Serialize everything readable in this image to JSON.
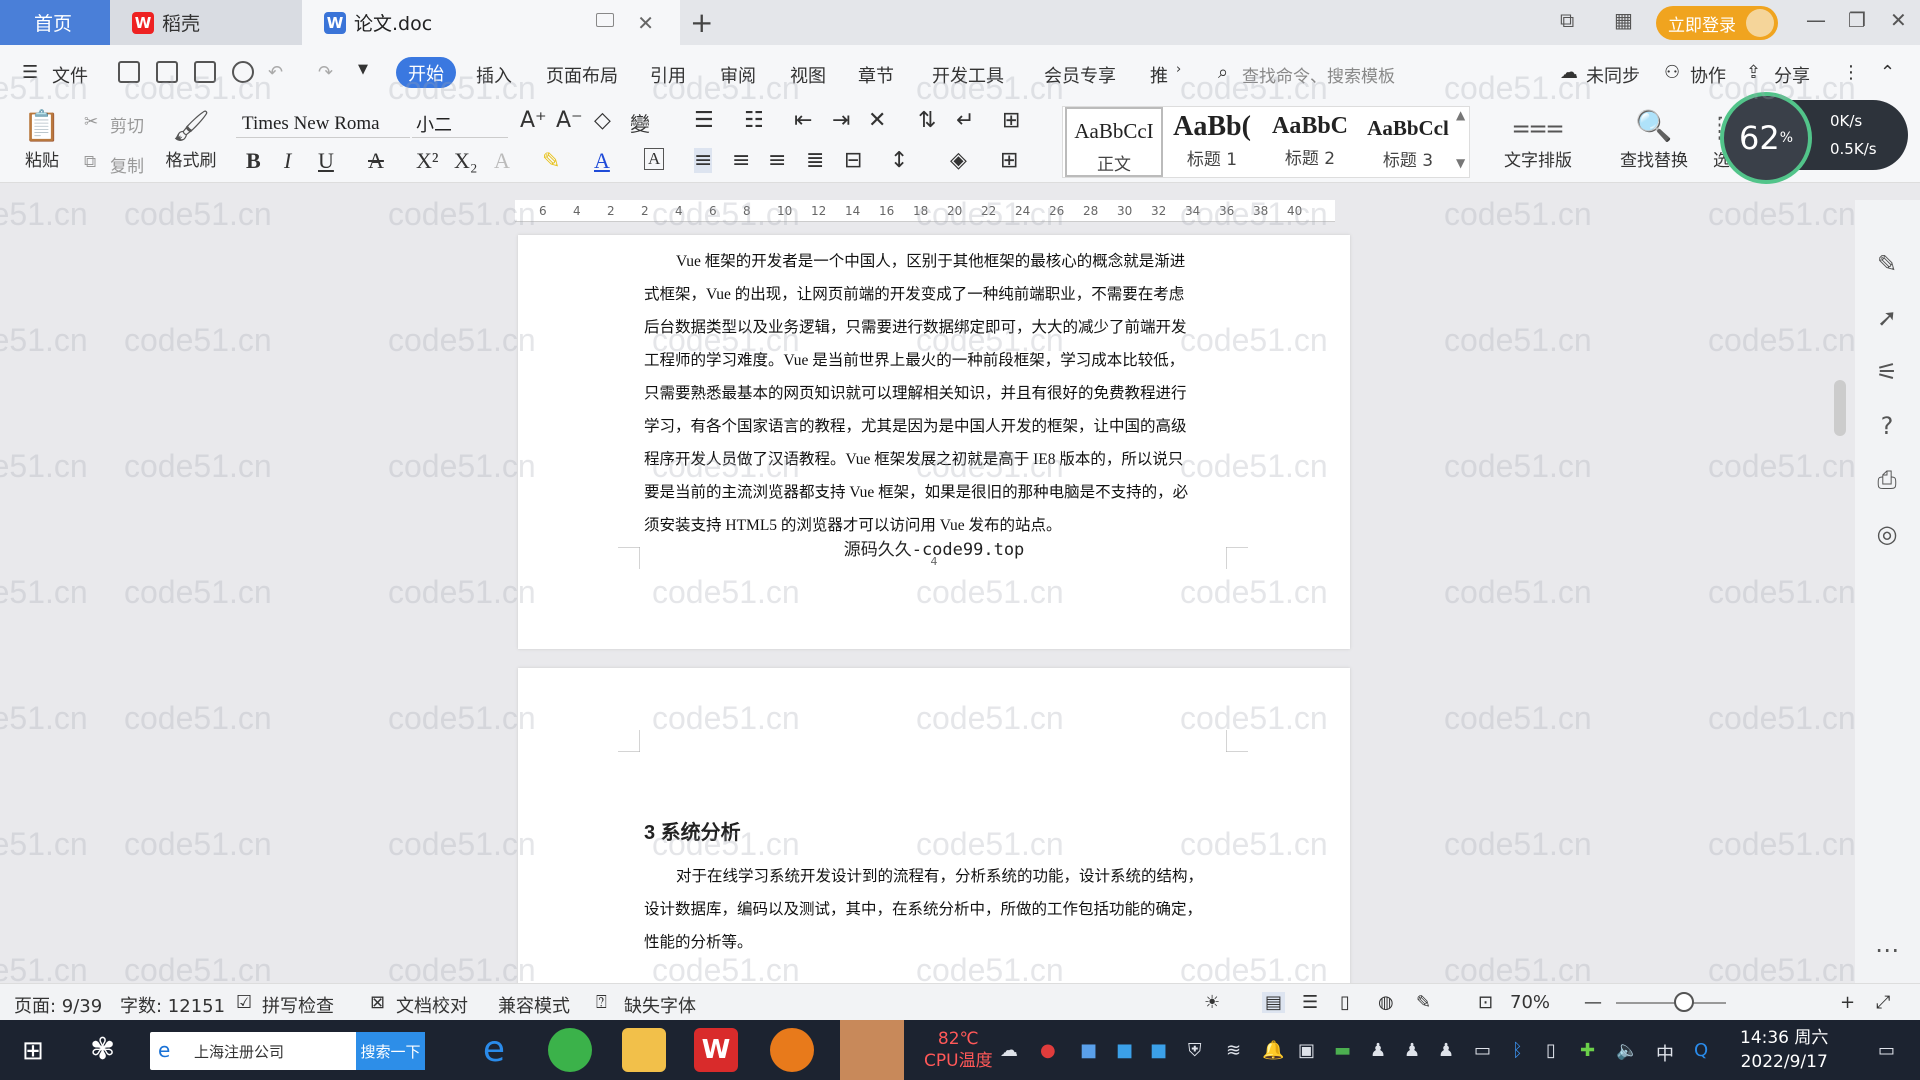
{
  "tabs": {
    "home": "首页",
    "daoke": "稻壳",
    "doc": "论文.doc"
  },
  "header": {
    "login": "立即登录"
  },
  "menu": {
    "file": "文件",
    "items": [
      "开始",
      "插入",
      "页面布局",
      "引用",
      "审阅",
      "视图",
      "章节",
      "开发工具",
      "会员专享",
      "推"
    ],
    "search_cmd": "查找命令、搜索模板",
    "unsynced": "未同步",
    "collab": "协作",
    "share": "分享"
  },
  "ribbon": {
    "paste": "粘贴",
    "cut": "剪切",
    "copy": "复制",
    "format_painter": "格式刷",
    "font_name": "Times New Roma",
    "font_size": "小二",
    "styles": [
      {
        "preview": "AaBbCcI",
        "name": "正文"
      },
      {
        "preview": "AaBb(",
        "name": "标题 1"
      },
      {
        "preview": "AaBbC",
        "name": "标题 2"
      },
      {
        "preview": "AaBbCcl",
        "name": "标题 3"
      }
    ],
    "text_layout": "文字排版",
    "find_replace": "查找替换",
    "select": "选择"
  },
  "speed": {
    "cpu_percent": "62",
    "percent_sign": "%",
    "up": "0K/s",
    "down": "0.5K/s"
  },
  "ruler_ticks": [
    "6",
    "4",
    "2",
    "2",
    "4",
    "6",
    "8",
    "10",
    "12",
    "14",
    "16",
    "18",
    "20",
    "22",
    "24",
    "26",
    "28",
    "30",
    "32",
    "34",
    "36",
    "38",
    "40"
  ],
  "doc": {
    "page1_lines": [
      "Vue 框架的开发者是一个中国人，区别于其他框架的最核心的概念就是渐进",
      "式框架，Vue 的出现，让网页前端的开发变成了一种纯前端职业，不需要在考虑",
      "后台数据类型以及业务逻辑，只需要进行数据绑定即可，大大的减少了前端开发",
      "工程师的学习难度。Vue 是当前世界上最火的一种前段框架，学习成本比较低，",
      "只需要熟悉最基本的网页知识就可以理解相关知识，并且有很好的免费教程进行",
      "学习，有各个国家语言的教程，尤其是因为是中国人开发的框架，让中国的高级",
      "程序开发人员做了汉语教程。Vue 框架发展之初就是高于 IE8 版本的，所以说只",
      "要是当前的主流浏览器都支持 Vue 框架，如果是很旧的那种电脑是不支持的，必",
      "须安装支持 HTML5 的浏览器才可以访问用 Vue 发布的站点。"
    ],
    "footer_text": "源码久久-code99.top",
    "page_number": "4",
    "heading": "3  系统分析",
    "page2_lines": [
      "对于在线学习系统开发设计到的流程有，分析系统的功能，设计系统的结构，",
      "设计数据库，编码以及测试，其中，在系统分析中，所做的工作包括功能的确定，",
      "性能的分析等。"
    ]
  },
  "status": {
    "page": "页面: 9/39",
    "words": "字数: 12151",
    "spell": "拼写检查",
    "proofread": "文档校对",
    "compat": "兼容模式",
    "missing_font": "缺失字体",
    "zoom": "70%"
  },
  "taskbar": {
    "search_text": "上海注册公司",
    "search_btn": "搜索一下",
    "temp": "82℃",
    "temp_label": "CPU温度",
    "time": "14:36 周六",
    "date": "2022/9/17",
    "ime": "中"
  },
  "watermark": "code51.cn"
}
